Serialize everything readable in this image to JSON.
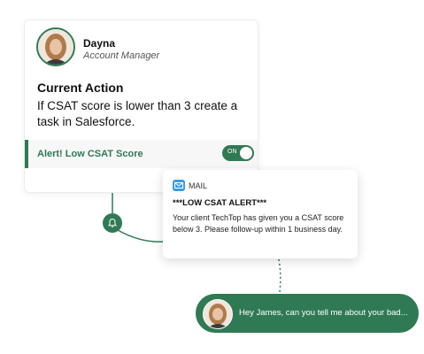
{
  "profile": {
    "name": "Dayna",
    "role": "Account Manager"
  },
  "action": {
    "title": "Current Action",
    "description": "If CSAT score is lower than 3 create a task in Salesforce."
  },
  "alert": {
    "label": "Alert! Low CSAT Score",
    "toggle_text": "ON",
    "enabled": true
  },
  "mail": {
    "label": "MAIL",
    "title": "***LOW CSAT ALERT***",
    "body": "Your client TechTop has given you a CSAT score below 3. Please follow-up within 1 business day."
  },
  "chat": {
    "message": "Hey James, can you tell me about your bad..."
  },
  "colors": {
    "brand_green": "#2f7a55",
    "mail_blue": "#3a9be8"
  },
  "icons": {
    "bell": "bell-icon",
    "mail": "mail-icon"
  }
}
